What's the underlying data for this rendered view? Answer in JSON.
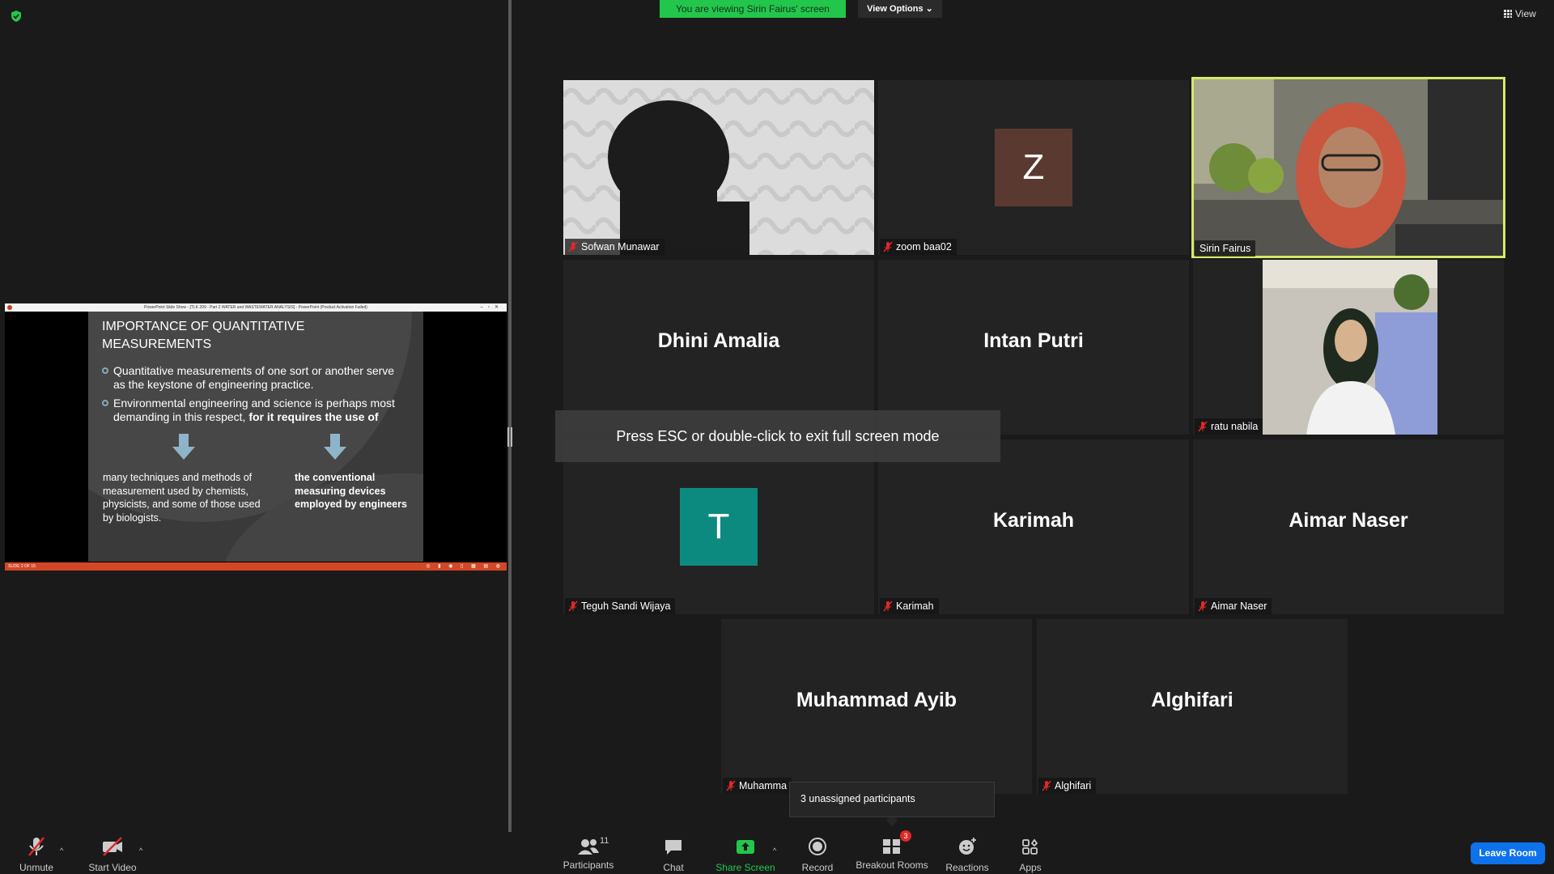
{
  "banner": {
    "viewing_text": "You are viewing Sirin Fairus' screen",
    "view_options_label": "View Options",
    "view_label": "View"
  },
  "shared_screen": {
    "titlebar_text": "PowerPoint Slide Show - [TLK 209 - Part 2 WATER and WASTEWATER ANALYSIS] - PowerPoint (Product Activation Failed)",
    "statusbar_text": "SLIDE 2 OF 15",
    "slide": {
      "title": "IMPORTANCE OF QUANTITATIVE MEASUREMENTS",
      "bullet1": "Quantitative measurements of one sort or another serve as the keystone of engineering practice.",
      "bullet2_normal": "Environmental engineering and science is perhaps most demanding in this respect, ",
      "bullet2_bold": "for it requires the use of",
      "col1": "many techniques and methods of measurement used by chemists, physicists, and some of those used by biologists.",
      "col2": "the conventional measuring devices employed by engineers"
    }
  },
  "tiles": [
    {
      "name": "Sofwan Munawar"
    },
    {
      "name": "zoom baa02",
      "avatar": "Z",
      "avatar_color": "#5a3a30"
    },
    {
      "name": "Sirin Fairus"
    },
    {
      "name": "Dhini Amalia",
      "label": "Dhini Amalia"
    },
    {
      "name": "Intan Putri",
      "label": "Intan Putri"
    },
    {
      "name": "ratu nabila"
    },
    {
      "name": "Teguh Sandi Wijaya",
      "avatar": "T",
      "avatar_color": "#0c8a80"
    },
    {
      "name": "Karimah",
      "label": "Karimah"
    },
    {
      "name": "Aimar Naser",
      "label": "Aimar Naser"
    },
    {
      "name": "Muhammad Ayib",
      "label": "Muhamma"
    },
    {
      "name": "Alghifari",
      "label": "Alghifari"
    }
  ],
  "esc_toast": "Press ESC or double-click to exit full screen mode",
  "unassigned_tip": "3 unassigned participants",
  "toolbar": {
    "unmute": "Unmute",
    "start_video": "Start Video",
    "participants": "Participants",
    "participants_count": "11",
    "chat": "Chat",
    "share_screen": "Share Screen",
    "record": "Record",
    "breakout_rooms": "Breakout Rooms",
    "breakout_badge": "3",
    "reactions": "Reactions",
    "apps": "Apps",
    "leave_room": "Leave Room"
  },
  "colors": {
    "speaking_outline": "#d6e86a",
    "viewing_banner": "#23c64c",
    "share_screen": "#23c64c",
    "leave_button": "#0e72ed",
    "mute_red": "#e02828"
  }
}
